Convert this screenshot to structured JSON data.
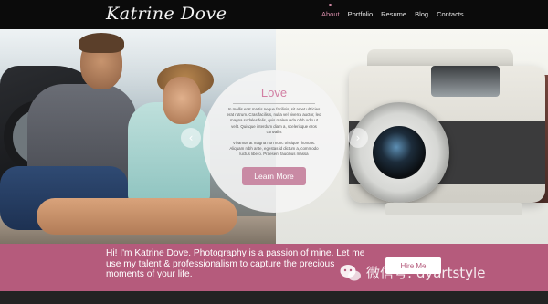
{
  "header": {
    "logo": "Katrine Dove",
    "nav": [
      {
        "label": "About",
        "active": true
      },
      {
        "label": "Portfolio",
        "active": false
      },
      {
        "label": "Resume",
        "active": false
      },
      {
        "label": "Blog",
        "active": false
      },
      {
        "label": "Contacts",
        "active": false
      }
    ]
  },
  "hero": {
    "prev_icon": "chevron-left-icon",
    "next_icon": "chevron-right-icon",
    "prev_glyph": "‹",
    "next_glyph": "›",
    "circle": {
      "title": "Love",
      "paragraph1": "In mollis erat mattis neque facilisis, sit amet ultricies erat rutrum. Cras facilisis, nulla vel viverra auctor, leo magna sodales felis, quis malesuada nibh odio ut velit. Quisque interdum diam a, scelerisque eros convallis",
      "paragraph2": "Vivamus at magna non nunc tristique rhoncus. Aliquam nibh ante, egestas id dictum a, commodo luctus libero. Praesent faucibus massa",
      "button": "Learn More"
    }
  },
  "banner": {
    "text": "Hi! I'm Katrine Dove. Photography is a passion of mine. Let me use my talent & professionalism to capture the precious moments of your life.",
    "button": "Hire Me",
    "watermark": "微信号: dyartstyle",
    "watermark_icon": "wechat-icon"
  },
  "colors": {
    "accent": "#d58ba8",
    "banner": "#b55b7c",
    "header": "#0b0b0b"
  }
}
